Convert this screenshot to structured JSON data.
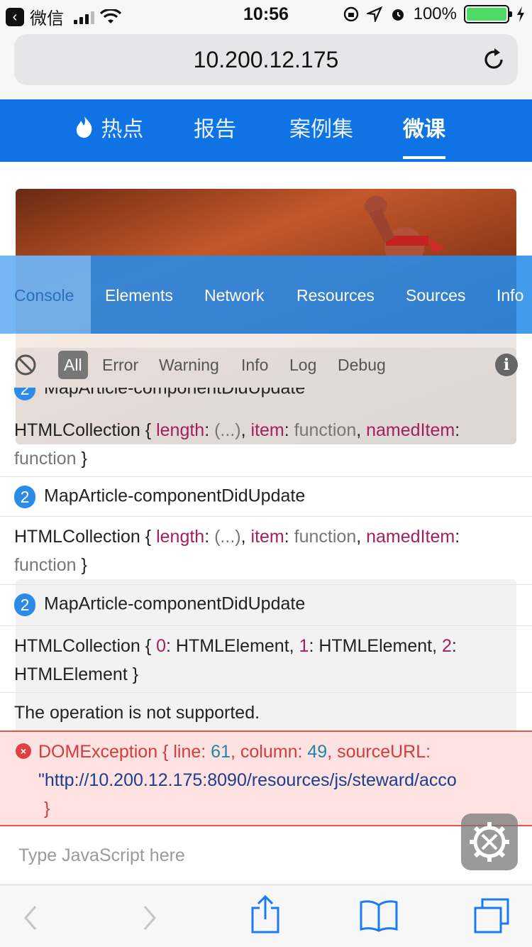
{
  "status_bar": {
    "carrier": "微信",
    "time": "10:56",
    "battery": "100%",
    "icons": [
      "back-icon",
      "signal-icon",
      "wifi-icon",
      "rotation-lock-icon",
      "location-icon",
      "alarm-icon",
      "battery-icon",
      "charging-icon"
    ]
  },
  "url_bar": {
    "url": "10.200.12.175"
  },
  "site_nav": {
    "items": [
      {
        "label": "热点",
        "icon": "flame-icon"
      },
      {
        "label": "报告"
      },
      {
        "label": "案例集"
      },
      {
        "label": "微课",
        "active": true
      }
    ]
  },
  "console": {
    "tabs": [
      "Console",
      "Elements",
      "Network",
      "Resources",
      "Sources",
      "Info"
    ],
    "active_tab": "Console",
    "filters": [
      "All",
      "Error",
      "Warning",
      "Info",
      "Log",
      "Debug"
    ],
    "active_filter": "All",
    "logs": {
      "partial_header": {
        "count": "2",
        "text": "MapArticle-componentDidUpdate"
      },
      "row1": {
        "open": "HTMLCollection { ",
        "k1": "length",
        "sep1": ": ",
        "v1": "(...)",
        "c1": ", ",
        "k2": "item",
        "sep2": ": ",
        "v2": "function",
        "c2": ", ",
        "k3": "namedItem",
        "sep3": ":",
        "v3": "function",
        "close": " }"
      },
      "group2": {
        "count": "2",
        "text": "MapArticle-componentDidUpdate"
      },
      "row2": {
        "open": "HTMLCollection { ",
        "k1": "length",
        "sep1": ": ",
        "v1": "(...)",
        "c1": ", ",
        "k2": "item",
        "sep2": ": ",
        "v2": "function",
        "c2": ", ",
        "k3": "namedItem",
        "sep3": ":",
        "v3": "function",
        "close": " }"
      },
      "group3": {
        "count": "2",
        "text": "MapArticle-componentDidUpdate"
      },
      "row3": {
        "open": "HTMLCollection { ",
        "k1": "0",
        "v1": ": HTMLElement, ",
        "k2": "1",
        "v2": ": HTMLElement, ",
        "k3": "2",
        "v3": ":",
        "line2": "HTMLElement }"
      },
      "plain": "The operation is not supported.",
      "error": {
        "label": "DOMException { line: ",
        "line": "61",
        "col_label": ", column: ",
        "column": "49",
        "src_label": ", sourceURL:",
        "url": "\"http://10.200.12.175:8090/resources/js/steward/acco",
        "close": "}"
      }
    },
    "input_placeholder": "Type JavaScript here"
  },
  "safari_toolbar": {
    "icons": [
      "back-chevron-icon",
      "forward-chevron-icon",
      "share-icon",
      "bookmarks-icon",
      "tabs-icon"
    ]
  },
  "colors": {
    "nav_blue": "#0f73e6",
    "console_tab_blue": "#288ceb",
    "key_color": "#a3205f",
    "number_color": "#1f87a3",
    "error_red": "#d23c3c",
    "badge_blue": "#2d8ae6"
  }
}
